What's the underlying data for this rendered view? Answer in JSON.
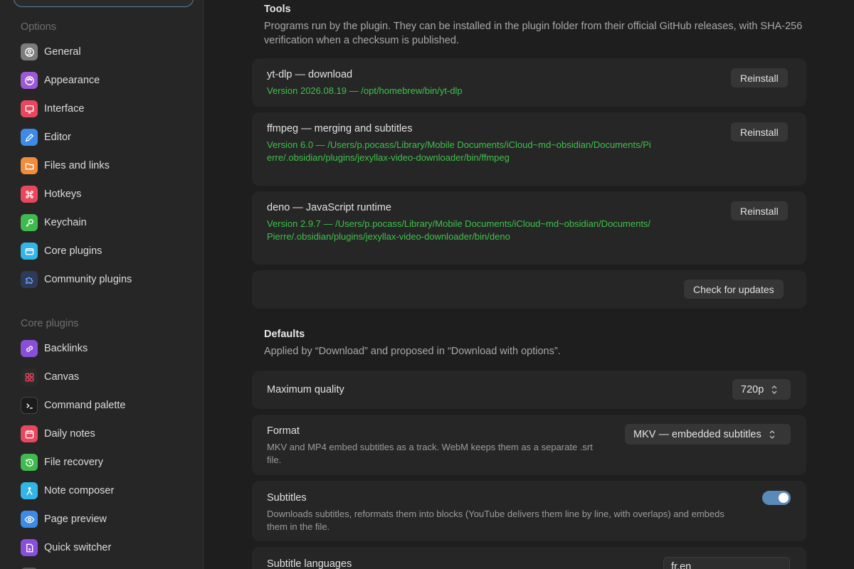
{
  "sidebar": {
    "options_header": "Options",
    "options_items": [
      {
        "label": "General",
        "icon": "general-icon",
        "color": "#7c7c7c"
      },
      {
        "label": "Appearance",
        "icon": "palette-icon",
        "color": "#9b59d6"
      },
      {
        "label": "Interface",
        "icon": "monitor-icon",
        "color": "#e8475d"
      },
      {
        "label": "Editor",
        "icon": "pencil-icon",
        "color": "#3d8be6"
      },
      {
        "label": "Files and links",
        "icon": "folder-icon",
        "color": "#f08c3a"
      },
      {
        "label": "Hotkeys",
        "icon": "command-icon",
        "color": "#e8475d"
      },
      {
        "label": "Keychain",
        "icon": "key-icon",
        "color": "#3fb950"
      },
      {
        "label": "Core plugins",
        "icon": "plugin-icon",
        "color": "#32b5e8"
      },
      {
        "label": "Community plugins",
        "icon": "puzzle-icon",
        "color": "#2f3a57"
      }
    ],
    "core_header": "Core plugins",
    "core_items": [
      {
        "label": "Backlinks",
        "icon": "backlinks-icon",
        "color": "#8a4fd8"
      },
      {
        "label": "Canvas",
        "icon": "canvas-icon",
        "color": "#2a2a2a"
      },
      {
        "label": "Command palette",
        "icon": "terminal-icon",
        "color": "#1c1c1c"
      },
      {
        "label": "Daily notes",
        "icon": "calendar-icon",
        "color": "#e8475d"
      },
      {
        "label": "File recovery",
        "icon": "history-icon",
        "color": "#3fb950"
      },
      {
        "label": "Note composer",
        "icon": "merge-icon",
        "color": "#32b5e8"
      },
      {
        "label": "Page preview",
        "icon": "preview-icon",
        "color": "#3d8be6"
      },
      {
        "label": "Quick switcher",
        "icon": "switcher-icon",
        "color": "#8a4fd8"
      }
    ]
  },
  "tools": {
    "heading": "Tools",
    "description": "Programs run by the plugin. They can be installed in the plugin folder from their official GitHub releases, with SHA-256 verification when a checksum is published.",
    "items": [
      {
        "title": "yt-dlp — download",
        "path": "Version 2026.08.19 — /opt/homebrew/bin/yt-dlp",
        "button": "Reinstall"
      },
      {
        "title": "ffmpeg — merging and subtitles",
        "path": "Version 6.0 — /Users/p.pocass/Library/Mobile Documents/iCloud~md~obsidian/Documents/Pierre/.obsidian/plugins/jexyllax-video-downloader/bin/ffmpeg",
        "button": "Reinstall"
      },
      {
        "title": "deno — JavaScript runtime",
        "path": "Version 2.9.7 — /Users/p.pocass/Library/Mobile Documents/iCloud~md~obsidian/Documents/Pierre/.obsidian/plugins/jexyllax-video-downloader/bin/deno",
        "button": "Reinstall"
      }
    ],
    "check_updates": "Check for updates"
  },
  "defaults": {
    "heading": "Defaults",
    "description": "Applied by “Download” and proposed in “Download with options”.",
    "max_quality": {
      "label": "Maximum quality",
      "value": "720p"
    },
    "format": {
      "label": "Format",
      "value": "MKV — embedded subtitles",
      "description": "MKV and MP4 embed subtitles as a track. WebM keeps them as a separate .srt file."
    },
    "subtitles": {
      "label": "Subtitles",
      "description": "Downloads subtitles, reformats them into blocks (YouTube delivers them line by line, with overlaps) and embeds them in the file.",
      "enabled": true
    },
    "subtitle_languages": {
      "label": "Subtitle languages",
      "value": "fr,en"
    }
  }
}
